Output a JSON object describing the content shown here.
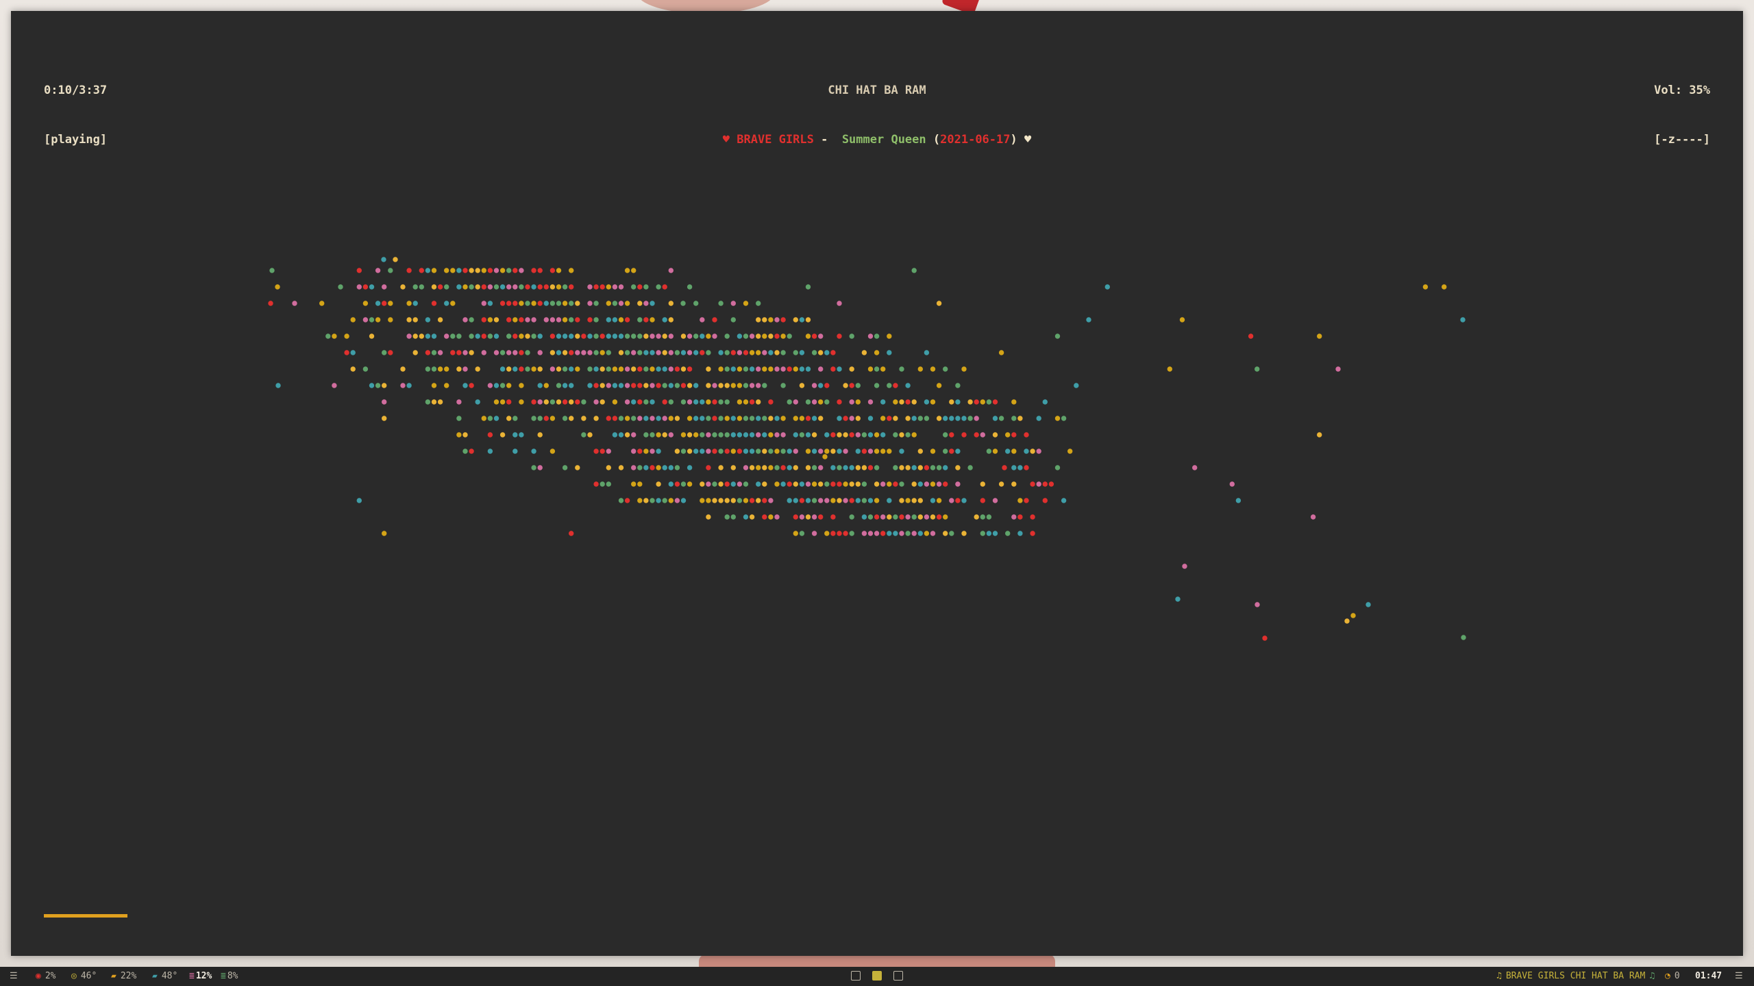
{
  "player": {
    "elapsed_total": "0:10/3:37",
    "state": "[playing]",
    "album": "CHI HAT BA RAM",
    "artist": "BRAVE GIRLS",
    "separator": " - ",
    "title": "Summer Queen",
    "date": "2021-06-17",
    "heart_left": "♥",
    "heart_right": "♥",
    "open_paren": "(",
    "close_paren": ")",
    "volume": "Vol: 35%",
    "volume_bar": "[-z----]",
    "progress_fraction": 0.05,
    "colors": {
      "accent_red": "#e0302e",
      "accent_green": "#8fbf6a",
      "progress": "#e0a01f",
      "dot_palette": [
        "#5fa36a",
        "#d4a417",
        "#e0302e",
        "#d16d9e",
        "#3f9ea8",
        "#eab336"
      ]
    }
  },
  "statusbar": {
    "left_menu_icon": "☰",
    "cpu": "2%",
    "cpu_temp": "46°",
    "ram": "22%",
    "gpu_temp": "48°",
    "disk1": "12%",
    "disk2": "8%",
    "workspaces": [
      "",
      "",
      ""
    ],
    "now_playing": "BRAVE GIRLS CHI HAT BA RAM",
    "notifications": "0",
    "clock": "01:47",
    "right_menu_icon": "☰",
    "icons": {
      "cpu": "cpu-icon",
      "temp": "thermometer-icon",
      "ram": "memory-icon",
      "gpu": "gpu-icon",
      "disk": "disk-icon",
      "music": "music-icon",
      "bell": "bell-icon"
    }
  }
}
